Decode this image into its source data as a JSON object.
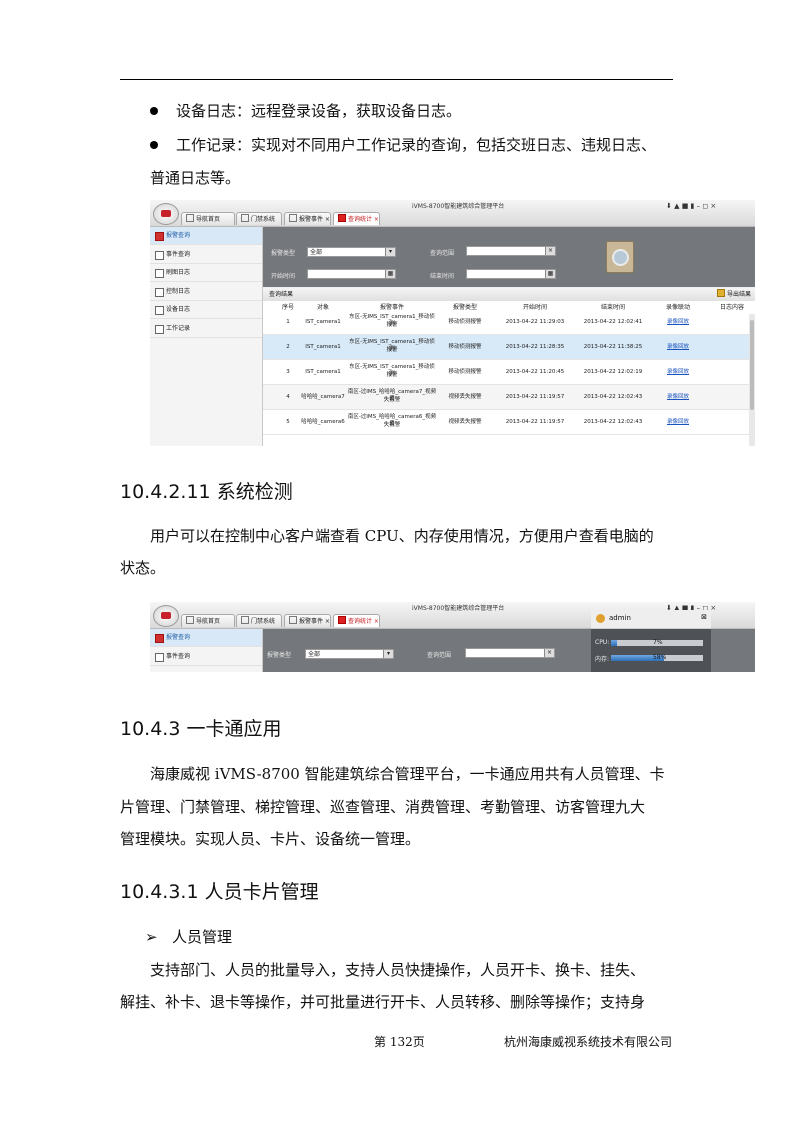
{
  "bullets": [
    "设备日志：远程登录设备，获取设备日志。",
    "工作记录：实现对不同用户工作记录的查询，包括交班日志、违规日志、",
    "普通日志等。"
  ],
  "screenshot1": {
    "app_title": "iVMS-8700智能建筑综合管理平台",
    "tabs": [
      {
        "label": "导航首页"
      },
      {
        "label": "门禁系统 ×"
      },
      {
        "label": "报警事件 ×"
      },
      {
        "label": "查询统计 ×"
      }
    ],
    "window_controls": "⬇ ▲ ■   ▮ – ◻ ×",
    "sidebar": [
      "报警查询",
      "事件查询",
      "刷图日志",
      "控制日志",
      "设备日志",
      "工作记录"
    ],
    "filters": {
      "alarm_type_label": "报警类型",
      "alarm_type_value": "全部",
      "query_range_label": "查询范围",
      "start_label": "开始时间",
      "end_label": "结束时间"
    },
    "results_label": "查询结果",
    "export_label": "导出结果",
    "columns": [
      "序号",
      "对象",
      "报警事件",
      "报警类型",
      "开始时间",
      "结束时间",
      "录像联动",
      "日志内容"
    ],
    "rows": [
      {
        "no": "1",
        "obj": "IST_camera1",
        "event1": "东区-无IMS_IST_camera1_移动侦测",
        "event2": "报警",
        "type": "移动侦测报警",
        "start": "2013-04-22 11:29:03",
        "end": "2013-04-22 12:02:41",
        "link": "录像回放"
      },
      {
        "no": "2",
        "obj": "IST_camera1",
        "event1": "东区-无IMS_IST_camera1_移动侦测",
        "event2": "报警",
        "type": "移动侦测报警",
        "start": "2013-04-22 11:28:35",
        "end": "2013-04-22 11:38:25",
        "link": "录像回放"
      },
      {
        "no": "3",
        "obj": "IST_camera1",
        "event1": "东区-无IMS_IST_camera1_移动侦测",
        "event2": "报警",
        "type": "移动侦测报警",
        "start": "2013-04-22 11:20:45",
        "end": "2013-04-22 12:02:19",
        "link": "录像回放"
      },
      {
        "no": "4",
        "obj": "哈哈哈_camera7",
        "event1": "南区-过IMS_哈哈哈_camera7_视频丢",
        "event2": "失报警",
        "type": "视频丢失报警",
        "start": "2013-04-22 11:19:57",
        "end": "2013-04-22 12:02:43",
        "link": "录像回放"
      },
      {
        "no": "5",
        "obj": "哈哈哈_camera6",
        "event1": "南区-过IMS_哈哈哈_camera6_视频丢",
        "event2": "失报警",
        "type": "视频丢失报警",
        "start": "2013-04-22 11:19:57",
        "end": "2013-04-22 12:02:43",
        "link": "录像回放"
      }
    ]
  },
  "section1": {
    "heading": "10.4.2.11 系统检测",
    "para_line1": "用户可以在控制中心客户端查看 CPU、内存使用情况，方便用户查看电脑的",
    "para_line2": "状态。"
  },
  "screenshot2": {
    "app_title": "iVMS-8700智能建筑综合管理平台",
    "sidebar": [
      "报警查询",
      "事件查询"
    ],
    "alarm_type_label": "报警类型",
    "alarm_type_value": "全部",
    "query_range_label": "查询范围",
    "user": "admin",
    "cpu_label": "CPU:",
    "cpu_pct": "7%",
    "cpu_fraction": 0.07,
    "mem_label": "内存:",
    "mem_pct": "58%",
    "mem_fraction": 0.58
  },
  "section2": {
    "heading": "10.4.3  一卡通应用",
    "para_line1": "海康威视 iVMS-8700 智能建筑综合管理平台，一卡通应用共有人员管理、卡",
    "para_line2": "片管理、门禁管理、梯控管理、巡查管理、消费管理、考勤管理、访客管理九大",
    "para_line3": "管理模块。实现人员、卡片、设备统一管理。"
  },
  "section3": {
    "heading": "10.4.3.1  人员卡片管理",
    "arrow_item": "人员管理",
    "para_line1": "支持部门、人员的批量导入，支持人员快捷操作，人员开卡、换卡、挂失、",
    "para_line2": "解挂、补卡、退卡等操作，并可批量进行开卡、人员转移、删除等操作；支持身"
  },
  "footer": {
    "page": "第 132页",
    "company": "杭州海康威视系统技术有限公司"
  }
}
